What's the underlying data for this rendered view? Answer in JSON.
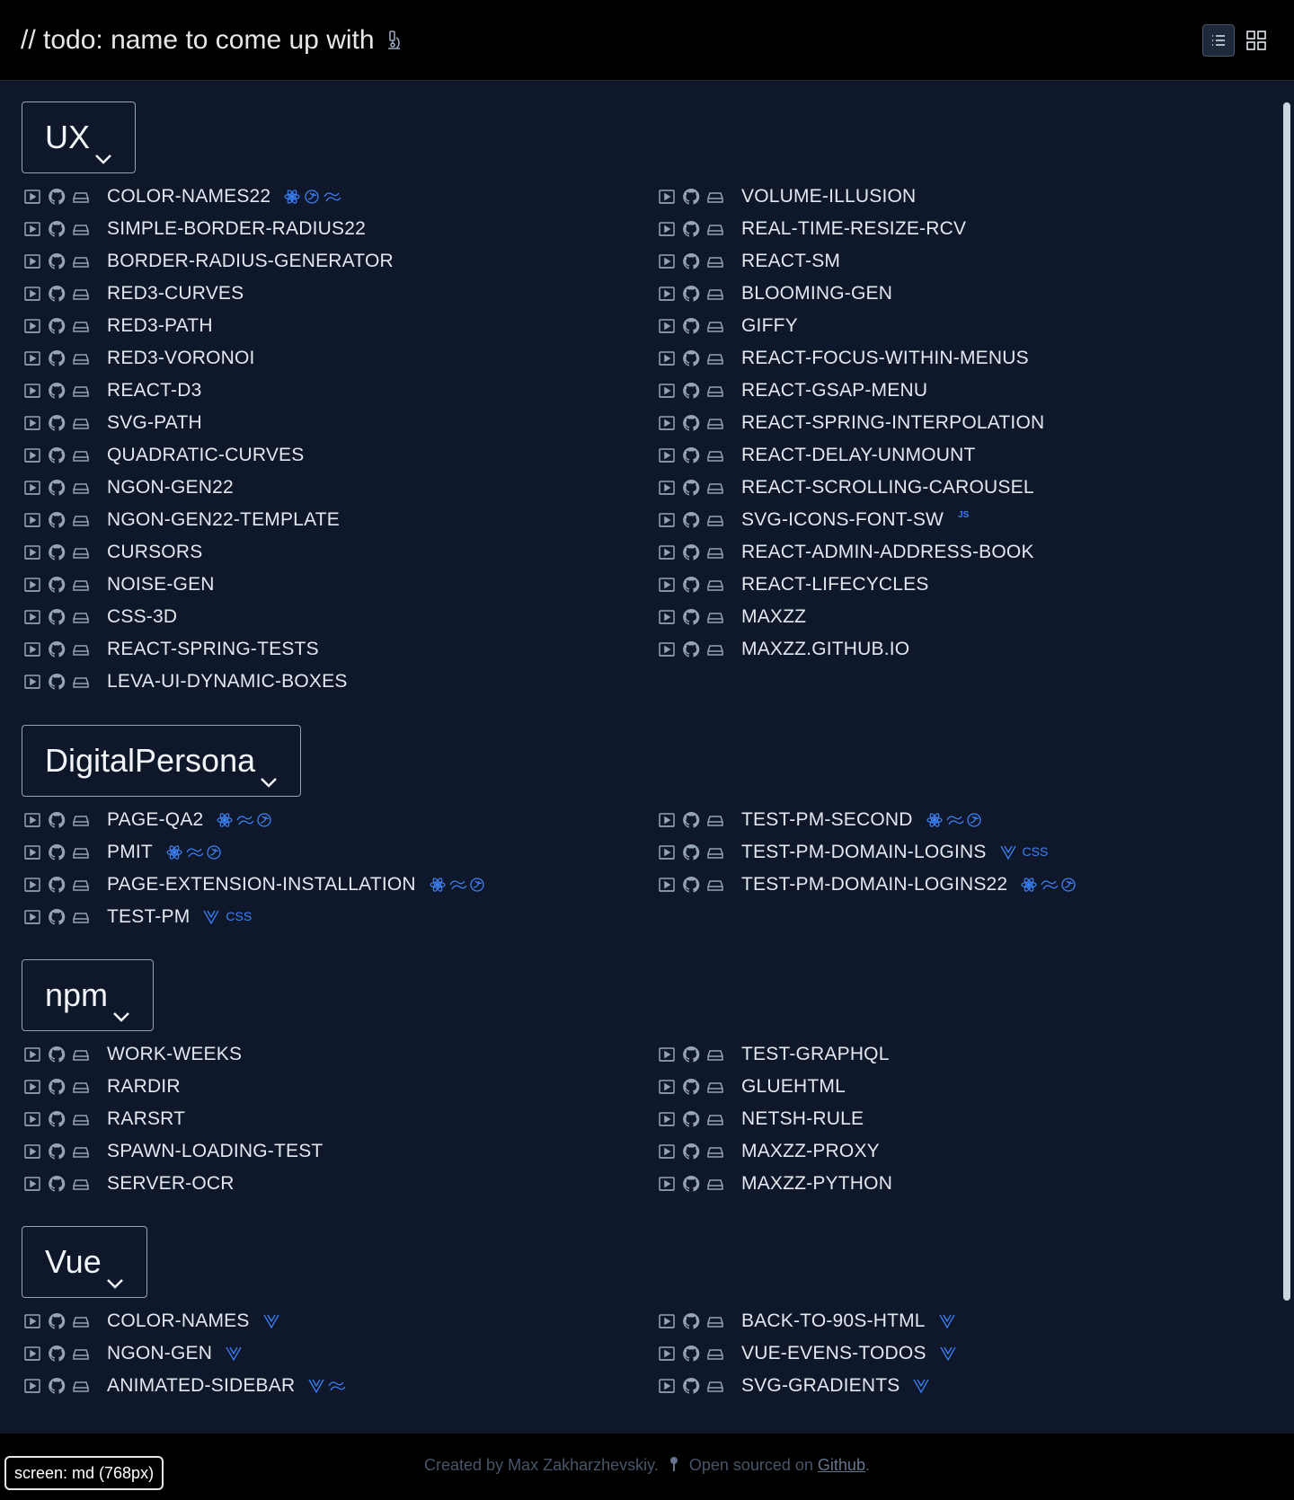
{
  "header": {
    "title": "// todo: name to come up with",
    "title_icon": "microscope-icon",
    "view_list_icon": "list-view-icon",
    "view_grid_icon": "grid-view-icon"
  },
  "colors": {
    "background": "#0f172a",
    "header_bg": "#000000",
    "accent": "#3b82f6",
    "text": "#e2e8f0"
  },
  "sections": [
    {
      "title": "UX",
      "left": [
        {
          "name": "COLOR-NAMES22",
          "tags": [
            "react",
            "redux",
            "tailwind"
          ]
        },
        {
          "name": "SIMPLE-BORDER-RADIUS22",
          "tags": []
        },
        {
          "name": "BORDER-RADIUS-GENERATOR",
          "tags": []
        },
        {
          "name": "RED3-CURVES",
          "tags": []
        },
        {
          "name": "RED3-PATH",
          "tags": []
        },
        {
          "name": "RED3-VORONOI",
          "tags": []
        },
        {
          "name": "REACT-D3",
          "tags": []
        },
        {
          "name": "SVG-PATH",
          "tags": []
        },
        {
          "name": "QUADRATIC-CURVES",
          "tags": []
        },
        {
          "name": "NGON-GEN22",
          "tags": []
        },
        {
          "name": "NGON-GEN22-TEMPLATE",
          "tags": []
        },
        {
          "name": "CURSORS",
          "tags": []
        },
        {
          "name": "NOISE-GEN",
          "tags": []
        },
        {
          "name": "CSS-3D",
          "tags": []
        },
        {
          "name": "REACT-SPRING-TESTS",
          "tags": []
        },
        {
          "name": "LEVA-UI-DYNAMIC-BOXES",
          "tags": []
        }
      ],
      "right": [
        {
          "name": "VOLUME-ILLUSION",
          "tags": []
        },
        {
          "name": "REAL-TIME-RESIZE-RCV",
          "tags": []
        },
        {
          "name": "REACT-SM",
          "tags": []
        },
        {
          "name": "BLOOMING-GEN",
          "tags": []
        },
        {
          "name": "GIFFY",
          "tags": []
        },
        {
          "name": "REACT-FOCUS-WITHIN-MENUS",
          "tags": []
        },
        {
          "name": "REACT-GSAP-MENU",
          "tags": []
        },
        {
          "name": "REACT-SPRING-INTERPOLATION",
          "tags": []
        },
        {
          "name": "REACT-DELAY-UNMOUNT",
          "tags": []
        },
        {
          "name": "REACT-SCROLLING-CAROUSEL",
          "tags": []
        },
        {
          "name": "SVG-ICONS-FONT-SW",
          "tags": [
            "js"
          ]
        },
        {
          "name": "REACT-ADMIN-ADDRESS-BOOK",
          "tags": []
        },
        {
          "name": "REACT-LIFECYCLES",
          "tags": []
        },
        {
          "name": "MAXZZ",
          "tags": []
        },
        {
          "name": "MAXZZ.GITHUB.IO",
          "tags": []
        }
      ]
    },
    {
      "title": "DigitalPersona",
      "left": [
        {
          "name": "PAGE-QA2",
          "tags": [
            "react",
            "tailwind",
            "redux"
          ]
        },
        {
          "name": "PMIT",
          "tags": [
            "react",
            "tailwind",
            "redux"
          ]
        },
        {
          "name": "PAGE-EXTENSION-INSTALLATION",
          "tags": [
            "react",
            "tailwind",
            "redux"
          ]
        },
        {
          "name": "TEST-PM",
          "tags": [
            "vue",
            "css"
          ]
        }
      ],
      "right": [
        {
          "name": "TEST-PM-SECOND",
          "tags": [
            "react",
            "tailwind",
            "redux"
          ]
        },
        {
          "name": "TEST-PM-DOMAIN-LOGINS",
          "tags": [
            "vue",
            "css"
          ]
        },
        {
          "name": "TEST-PM-DOMAIN-LOGINS22",
          "tags": [
            "react",
            "tailwind",
            "redux"
          ]
        }
      ]
    },
    {
      "title": "npm",
      "left": [
        {
          "name": "WORK-WEEKS",
          "tags": []
        },
        {
          "name": "RARDIR",
          "tags": []
        },
        {
          "name": "RARSRT",
          "tags": []
        },
        {
          "name": "SPAWN-LOADING-TEST",
          "tags": []
        },
        {
          "name": "SERVER-OCR",
          "tags": []
        }
      ],
      "right": [
        {
          "name": "TEST-GRAPHQL",
          "tags": []
        },
        {
          "name": "GLUEHTML",
          "tags": []
        },
        {
          "name": "NETSH-RULE",
          "tags": []
        },
        {
          "name": "MAXZZ-PROXY",
          "tags": []
        },
        {
          "name": "MAXZZ-PYTHON",
          "tags": []
        }
      ]
    },
    {
      "title": "Vue",
      "left": [
        {
          "name": "COLOR-NAMES",
          "tags": [
            "vue"
          ]
        },
        {
          "name": "NGON-GEN",
          "tags": [
            "vue"
          ]
        },
        {
          "name": "ANIMATED-SIDEBAR",
          "tags": [
            "vue",
            "tailwind"
          ]
        }
      ],
      "right": [
        {
          "name": "BACK-TO-90S-HTML",
          "tags": [
            "vue"
          ]
        },
        {
          "name": "VUE-EVENS-TODOS",
          "tags": [
            "vue"
          ]
        },
        {
          "name": "SVG-GRADIENTS",
          "tags": [
            "vue"
          ]
        }
      ]
    }
  ],
  "tag_labels": {
    "css": "CSS",
    "js": "JS"
  },
  "footer": {
    "created_by": "Created by Max Zakharzhevskiy.",
    "open_sourced": "Open sourced on",
    "github_link": "Github",
    "period": "."
  },
  "screen_badge": "screen: md (768px)"
}
